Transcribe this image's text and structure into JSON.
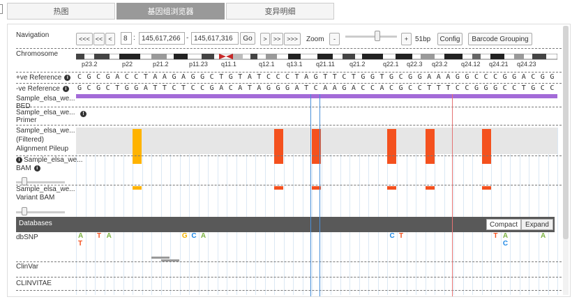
{
  "tabs": [
    {
      "label": "热图",
      "active": false
    },
    {
      "label": "基因组浏览器",
      "active": true
    },
    {
      "label": "变异明细",
      "active": false
    }
  ],
  "nav": {
    "label": "Navigation",
    "btn_first": "<<<",
    "btn_prev2": "<<",
    "btn_prev": "<",
    "chrom": "8",
    "sep": ":",
    "start": "145,617,266",
    "dash": "-",
    "end": "145,617,316",
    "go": "Go",
    "btn_next": ">",
    "btn_next2": ">>",
    "btn_last": ">>>",
    "zoom_label": "Zoom",
    "zoom_minus": "-",
    "zoom_plus": "+",
    "zoom_value": "51bp",
    "config": "Config",
    "barcode": "Barcode Grouping"
  },
  "chromosome": {
    "label": "Chromosome",
    "bands": [
      "p23.2",
      "p22",
      "p21.2",
      "p11.23",
      "q11.1",
      "q12.1",
      "q13.1",
      "q21.11",
      "q21.2",
      "q22.1",
      "q22.3",
      "q23.2",
      "q24.12",
      "q24.21",
      "q24.23"
    ]
  },
  "ref_pos": {
    "label": "+ve Reference",
    "sequence": "CGCGACCTAAGAGGCTGTATCCCTAGTTCTGGTGCGGAAAGGCCCGGACGG"
  },
  "ref_neg": {
    "label": "-ve Reference",
    "sequence": "GCGCTGGATTCTCCGACATAGGGATCAAGACCACGCCTTTCCGGGCCTGCC"
  },
  "tracks": {
    "bed": {
      "label": "Sample_elsa_we...",
      "sub": "BED"
    },
    "primer": {
      "label": "Sample_elsa_we...",
      "sub": "Primer"
    },
    "pileup": {
      "label": "Sample_elsa_we...",
      "sub1": "(Filtered)",
      "sub2": "Alignment Pileup"
    },
    "bam": {
      "label": "Sample_elsa_we...",
      "sub": "BAM"
    },
    "variant": {
      "label": "Sample_elsa_we...",
      "sub": "Variant BAM"
    }
  },
  "databases": {
    "title": "Databases",
    "compact": "Compact",
    "expand": "Expand",
    "dbsnp": "dbSNP",
    "clinvar": "ClinVar",
    "clinvitae": "CLINVITAE"
  },
  "snps": [
    {
      "pos": 0,
      "row": 0,
      "base": "A",
      "color": "#7cb342"
    },
    {
      "pos": 0,
      "row": 1,
      "base": "T",
      "color": "#f4511e"
    },
    {
      "pos": 2,
      "row": 0,
      "base": "T",
      "color": "#f4511e"
    },
    {
      "pos": 3,
      "row": 0,
      "base": "A",
      "color": "#7cb342"
    },
    {
      "pos": 11,
      "row": 0,
      "base": "G",
      "color": "#f4b400"
    },
    {
      "pos": 12,
      "row": 0,
      "base": "C",
      "color": "#1e88e5"
    },
    {
      "pos": 13,
      "row": 0,
      "base": "A",
      "color": "#7cb342"
    },
    {
      "pos": 33,
      "row": 0,
      "base": "C",
      "color": "#1e88e5"
    },
    {
      "pos": 34,
      "row": 0,
      "base": "T",
      "color": "#f4511e"
    },
    {
      "pos": 44,
      "row": 0,
      "base": "T",
      "color": "#f4511e"
    },
    {
      "pos": 45,
      "row": 0,
      "base": "A",
      "color": "#7cb342"
    },
    {
      "pos": 45,
      "row": 1,
      "base": "C",
      "color": "#1e88e5"
    },
    {
      "pos": 49,
      "row": 0,
      "base": "A",
      "color": "#7cb342"
    }
  ],
  "pileup_bars": [
    {
      "pos": 6,
      "color": "#ffb300"
    },
    {
      "pos": 21,
      "color": "#f4511e"
    },
    {
      "pos": 25,
      "color": "#f4511e"
    },
    {
      "pos": 33,
      "color": "#f4511e"
    },
    {
      "pos": 37,
      "color": "#f4511e"
    },
    {
      "pos": 43,
      "color": "#f4511e"
    }
  ],
  "colors": {
    "A": "#7cb342",
    "C": "#1e88e5",
    "G": "#f4b400",
    "T": "#f4511e",
    "bed": "#a36bd8",
    "active_tab": "#999999",
    "db_bar": "#595959"
  }
}
